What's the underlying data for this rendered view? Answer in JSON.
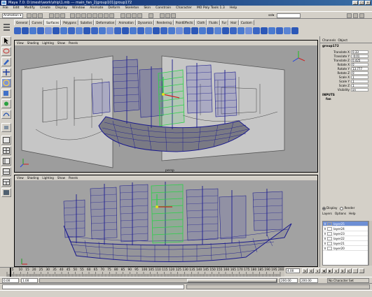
{
  "window": {
    "title": "Maya 7.0: D:\\mesh\\work\\ship\\1.mb  ---  main_fan_2|group101|group172"
  },
  "menubar": [
    "File",
    "Edit",
    "Modify",
    "Create",
    "Display",
    "Window",
    "Animate",
    "Deform",
    "Skeleton",
    "Skin",
    "Constrain",
    "Character",
    "MO Poly Tools 1.3",
    "Help"
  ],
  "statusline": {
    "menu_set": "Animation",
    "sel_label": "sel▾"
  },
  "shelf": {
    "tabs": [
      "General",
      "Curves",
      "Surfaces",
      "Polygons",
      "Subdivs",
      "Deformation",
      "Animation",
      "Dynamics",
      "Rendering",
      "PaintEffects",
      "Cloth",
      "Fluids",
      "Fur",
      "Hair",
      "Custom"
    ],
    "active_tab": "Surfaces",
    "icon_colors": [
      "#3a66c4",
      "#2c58b8",
      "#4a7ad0",
      "#3a66c4",
      "#6e8ed8",
      "#2c58b8",
      "#4a7ad0",
      "#3a66c4",
      "#5a84d4",
      "#2c58b8",
      "#3a66c4",
      "#4a7ad0",
      "#6e8ed8",
      "#3a66c4",
      "#2c58b8",
      "#4a7ad0",
      "#3a66c4",
      "#5a84d4",
      "#2c58b8",
      "#3a66c4",
      "#4a7ad0",
      "#6e8ed8",
      "#3a66c4",
      "#2c58b8",
      "#4a7ad0",
      "#3a66c4",
      "#5a84d4",
      "#2c58b8",
      "#3a66c4",
      "#4a7ad0",
      "#6e8ed8",
      "#3a66c4",
      "#2c58b8",
      "#4a7ad0",
      "#3a66c4",
      "#5a84d4",
      "#2c58b8"
    ]
  },
  "viewport_menu": [
    "View",
    "Shading",
    "Lighting",
    "Show",
    "Panels"
  ],
  "viewports": {
    "top_label": "persp"
  },
  "channel_box": {
    "tabs": [
      "Channels",
      "Object"
    ],
    "node": "group172",
    "attributes": [
      {
        "label": "Translate X",
        "value": "0.33"
      },
      {
        "label": "Translate Y",
        "value": "-0.01"
      },
      {
        "label": "Translate Z",
        "value": "0.425"
      },
      {
        "label": "Rotate X",
        "value": "0"
      },
      {
        "label": "Rotate Y",
        "value": "13.777"
      },
      {
        "label": "Rotate Z",
        "value": "0"
      },
      {
        "label": "Scale X",
        "value": "1"
      },
      {
        "label": "Scale Y",
        "value": "1"
      },
      {
        "label": "Scale Z",
        "value": "1"
      },
      {
        "label": "Visibility",
        "value": "on"
      }
    ],
    "inputs_label": "INPUTS",
    "inputs_item": "fan"
  },
  "layers": {
    "display_label": "Display",
    "render_label": "Render",
    "menu": [
      "Layers",
      "Options",
      "Help"
    ],
    "rows": [
      {
        "v": "V",
        "name": "layer25",
        "selected": true
      },
      {
        "v": "V",
        "name": "layer24",
        "selected": false
      },
      {
        "v": "V",
        "name": "layer23",
        "selected": false
      },
      {
        "v": "V",
        "name": "layer22",
        "selected": false
      },
      {
        "v": "V",
        "name": "layer21",
        "selected": false
      },
      {
        "v": "V",
        "name": "layer20",
        "selected": false
      }
    ]
  },
  "timeline": {
    "ticks": [
      "5",
      "10",
      "15",
      "20",
      "25",
      "30",
      "35",
      "40",
      "45",
      "50",
      "55",
      "60",
      "65",
      "70",
      "75",
      "80",
      "85",
      "90",
      "95",
      "100",
      "105",
      "110",
      "115",
      "120",
      "125",
      "130",
      "135",
      "140",
      "145",
      "150",
      "155",
      "160",
      "165",
      "170",
      "175",
      "180",
      "185",
      "190",
      "195",
      "200"
    ],
    "current_frame": "4.00"
  },
  "range": {
    "start": "0.00",
    "current": "1.00",
    "end": "200.00",
    "anim_end": "200.00",
    "character_set": "No Character Set"
  }
}
